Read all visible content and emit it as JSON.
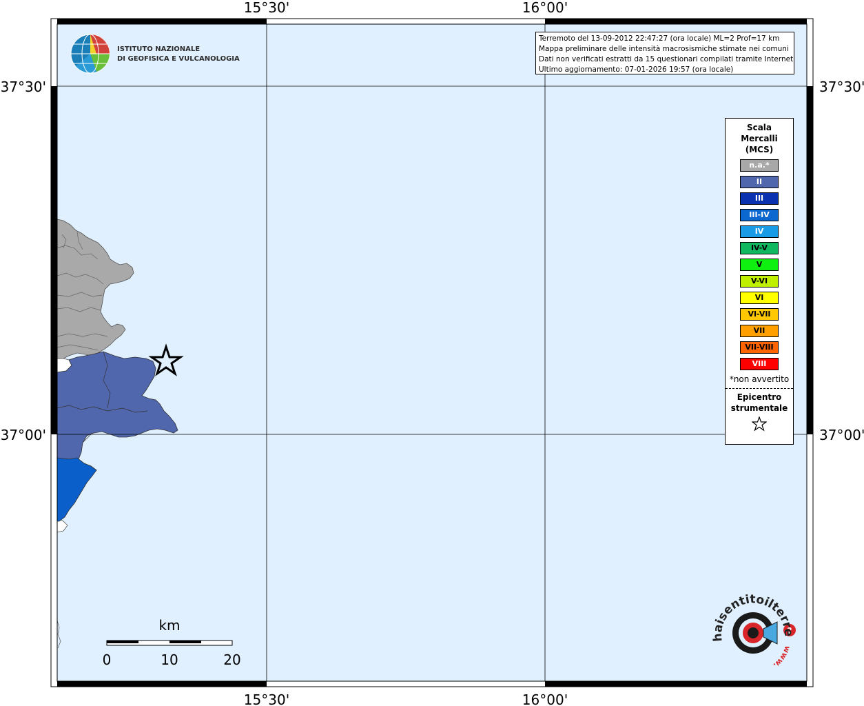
{
  "map": {
    "lon_labels": [
      "15°30'",
      "16°00'"
    ],
    "lat_labels": [
      "37°30'",
      "37°00'"
    ],
    "scale": {
      "unit": "km",
      "ticks": [
        "0",
        "10",
        "20"
      ]
    },
    "epicenter_marker": "star",
    "colors": {
      "sea": "#e0f0fe",
      "land_na": "#a9a9a9",
      "intensity_II": "#5066ad",
      "intensity_IV": "#0a5fcb"
    }
  },
  "logo": {
    "line1": "ISTITUTO NAZIONALE",
    "line2": "DI GEOFISICA E VULCANOLOGIA"
  },
  "info": {
    "line1": "Terremoto del 13-09-2012 22:47:27 (ora locale) ML=2 Prof=17 km",
    "line2": "Mappa preliminare delle intensità macrosismiche stimate nei comuni",
    "line3": "Dati non verificati estratti da 15 questionari compilati tramite Internet.",
    "line4": "Ultimo aggiornamento: 07-01-2026 19:57 (ora locale)"
  },
  "legend": {
    "title_lines": [
      "Scala",
      "Mercalli",
      "(MCS)"
    ],
    "items": [
      {
        "label": "n.a.*",
        "color": "#a8a8a8",
        "text_color": "#ffffff"
      },
      {
        "label": "II",
        "color": "#5066ad",
        "text_color": "#ffffff"
      },
      {
        "label": "III",
        "color": "#0a32b0",
        "text_color": "#ffffff"
      },
      {
        "label": "III-IV",
        "color": "#0a68d0",
        "text_color": "#ffffff"
      },
      {
        "label": "IV",
        "color": "#1a9be6",
        "text_color": "#ffffff"
      },
      {
        "label": "IV-V",
        "color": "#10b860",
        "text_color": "#000000"
      },
      {
        "label": "V",
        "color": "#10f010",
        "text_color": "#000000"
      },
      {
        "label": "V-VI",
        "color": "#bef000",
        "text_color": "#000000"
      },
      {
        "label": "VI",
        "color": "#ffff00",
        "text_color": "#000000"
      },
      {
        "label": "VI-VII",
        "color": "#ffc800",
        "text_color": "#000000"
      },
      {
        "label": "VII",
        "color": "#ffa000",
        "text_color": "#000000"
      },
      {
        "label": "VII-VIII",
        "color": "#ff6400",
        "text_color": "#000000"
      },
      {
        "label": "VIII",
        "color": "#ff0000",
        "text_color": "#ffffff"
      }
    ],
    "note": "*non avvertito",
    "epicenter_lines": [
      "Epicentro",
      "strumentale"
    ]
  },
  "hsit_logo": {
    "text": "haisentitoilterremoto.it",
    "prefix": "www."
  }
}
